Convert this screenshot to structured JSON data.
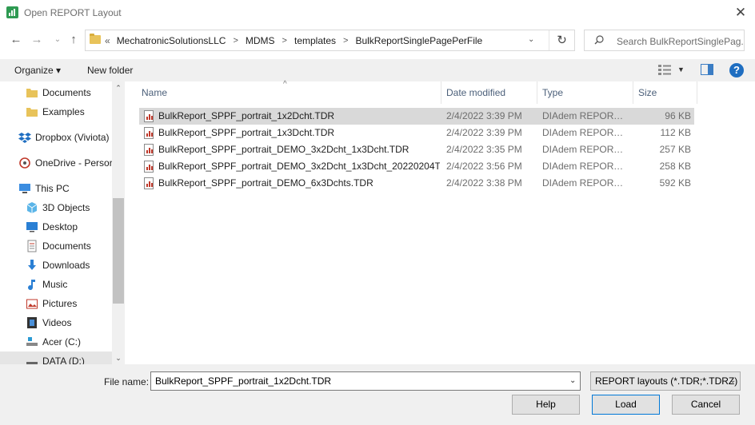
{
  "window": {
    "title": "Open REPORT Layout"
  },
  "address": {
    "crumbs": [
      "MechatronicSolutionsLLC",
      "MDMS",
      "templates",
      "BulkReportSinglePagePerFile"
    ],
    "overflow": "«"
  },
  "search": {
    "placeholder": "Search BulkReportSinglePag..."
  },
  "toolbar": {
    "organize": "Organize ▾",
    "new_folder": "New folder"
  },
  "nav": {
    "items": [
      {
        "label": "Documents",
        "icon": "folder-icon"
      },
      {
        "label": "Examples",
        "icon": "folder-icon"
      },
      {
        "label": "Dropbox (Viviota)",
        "icon": "dropbox-icon"
      },
      {
        "label": "OneDrive - Persor",
        "icon": "onedrive-icon"
      },
      {
        "label": "This PC",
        "icon": "computer-icon"
      },
      {
        "label": "3D Objects",
        "icon": "cube-icon"
      },
      {
        "label": "Desktop",
        "icon": "desktop-icon"
      },
      {
        "label": "Documents",
        "icon": "documents-icon"
      },
      {
        "label": "Downloads",
        "icon": "download-icon"
      },
      {
        "label": "Music",
        "icon": "music-icon"
      },
      {
        "label": "Pictures",
        "icon": "pictures-icon"
      },
      {
        "label": "Videos",
        "icon": "video-icon"
      },
      {
        "label": "Acer (C:)",
        "icon": "drive-icon"
      },
      {
        "label": "DATA (D:)",
        "icon": "drive-icon"
      }
    ]
  },
  "columns": {
    "name": "Name",
    "date": "Date modified",
    "type": "Type",
    "size": "Size"
  },
  "files": [
    {
      "name": "BulkReport_SPPF_portrait_1x2Dcht.TDR",
      "date": "2/4/2022 3:39 PM",
      "type": "DIAdem REPORT L...",
      "size": "96 KB"
    },
    {
      "name": "BulkReport_SPPF_portrait_1x3Dcht.TDR",
      "date": "2/4/2022 3:39 PM",
      "type": "DIAdem REPORT L...",
      "size": "112 KB"
    },
    {
      "name": "BulkReport_SPPF_portrait_DEMO_3x2Dcht_1x3Dcht.TDR",
      "date": "2/4/2022 3:35 PM",
      "type": "DIAdem REPORT L...",
      "size": "257 KB"
    },
    {
      "name": "BulkReport_SPPF_portrait_DEMO_3x2Dcht_1x3Dcht_20220204T2...",
      "date": "2/4/2022 3:56 PM",
      "type": "DIAdem REPORT L...",
      "size": "258 KB"
    },
    {
      "name": "BulkReport_SPPF_portrait_DEMO_6x3Dchts.TDR",
      "date": "2/4/2022 3:38 PM",
      "type": "DIAdem REPORT L...",
      "size": "592 KB"
    }
  ],
  "footer": {
    "file_name_label": "File name:",
    "file_name_value": "BulkReport_SPPF_portrait_1x2Dcht.TDR",
    "filter": "REPORT layouts (*.TDR;*.TDRZ)",
    "help": "Help",
    "load": "Load",
    "cancel": "Cancel"
  },
  "colors": {
    "accent": "#1f6ec1",
    "folder": "#e8c35a",
    "selection": "#d9d9d9"
  }
}
